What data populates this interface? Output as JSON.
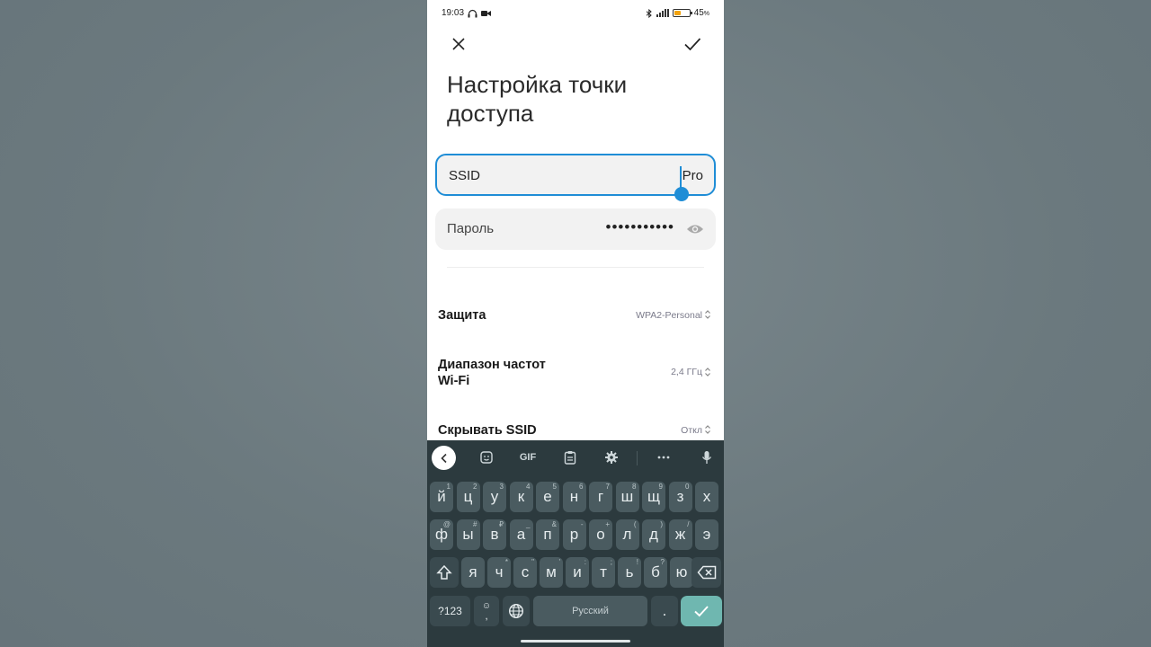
{
  "status_bar": {
    "time": "19:03",
    "battery_percent": "45",
    "battery_level": 0.45,
    "battery_color": "#f2a20d"
  },
  "header": {
    "title": "Настройка точки доступа"
  },
  "form": {
    "ssid": {
      "label": "SSID",
      "value": "Pro"
    },
    "password": {
      "label": "Пароль",
      "masked_value": "•••••••••••"
    }
  },
  "settings": [
    {
      "label": "Защита",
      "value": "WPA2-Personal"
    },
    {
      "label": "Диапазон частот Wi-Fi",
      "value": "2,4 ГГц"
    },
    {
      "label": "Скрывать SSID",
      "value": "Откл"
    }
  ],
  "keyboard": {
    "toolbar": {
      "gif_label": "GIF"
    },
    "row1": [
      {
        "char": "й",
        "hint": "1"
      },
      {
        "char": "ц",
        "hint": "2"
      },
      {
        "char": "у",
        "hint": "3"
      },
      {
        "char": "к",
        "hint": "4"
      },
      {
        "char": "е",
        "hint": "5"
      },
      {
        "char": "н",
        "hint": "6"
      },
      {
        "char": "г",
        "hint": "7"
      },
      {
        "char": "ш",
        "hint": "8"
      },
      {
        "char": "щ",
        "hint": "9"
      },
      {
        "char": "з",
        "hint": "0"
      },
      {
        "char": "х",
        "hint": ""
      }
    ],
    "row2": [
      {
        "char": "ф",
        "hint": "@"
      },
      {
        "char": "ы",
        "hint": "#"
      },
      {
        "char": "в",
        "hint": "₽"
      },
      {
        "char": "а",
        "hint": "_"
      },
      {
        "char": "п",
        "hint": "&"
      },
      {
        "char": "р",
        "hint": "-"
      },
      {
        "char": "о",
        "hint": "+"
      },
      {
        "char": "л",
        "hint": "("
      },
      {
        "char": "д",
        "hint": ")"
      },
      {
        "char": "ж",
        "hint": "/"
      },
      {
        "char": "э",
        "hint": ""
      }
    ],
    "row3": [
      {
        "char": "я",
        "hint": ""
      },
      {
        "char": "ч",
        "hint": "*"
      },
      {
        "char": "с",
        "hint": "\""
      },
      {
        "char": "м",
        "hint": "'"
      },
      {
        "char": "и",
        "hint": ":"
      },
      {
        "char": "т",
        "hint": ";"
      },
      {
        "char": "ь",
        "hint": "!"
      },
      {
        "char": "б",
        "hint": "?"
      },
      {
        "char": "ю",
        "hint": ""
      }
    ],
    "symbols_key": "?123",
    "emoji_key_hint": ",",
    "space_label": "Русский",
    "period_key": "."
  }
}
